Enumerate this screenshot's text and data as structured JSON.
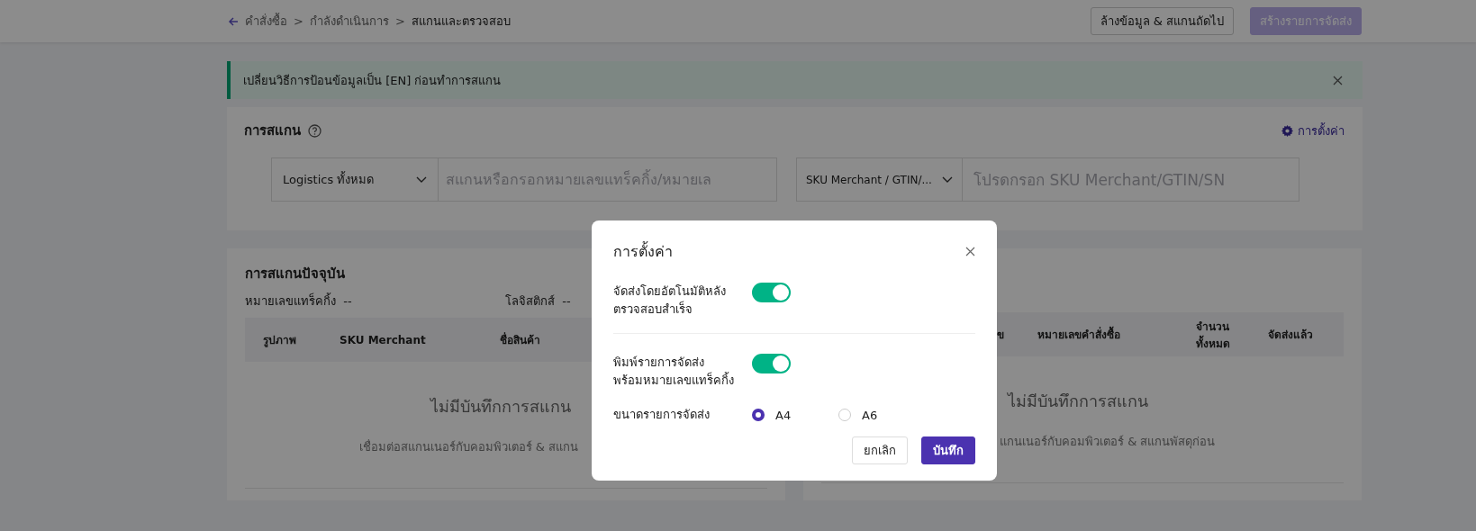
{
  "breadcrumb": {
    "separator": ">",
    "items": [
      {
        "label": "คำสั่งซื้อ",
        "current": false
      },
      {
        "label": "กำลังดำเนินการ",
        "current": false
      },
      {
        "label": "สแกนและตรวจสอบ",
        "current": true
      }
    ]
  },
  "header_buttons": [
    {
      "label": "ล้างข้อมูล & สแกนถัดไป",
      "kind": "outline",
      "disabled": false
    },
    {
      "label": "สร้างรายการจัดส่ง",
      "kind": "primary",
      "disabled": true
    }
  ],
  "alert": {
    "message": "เปลี่ยนวิธีการป้อนข้อมูลเป็น [EN] ก่อนทำการสแกน"
  },
  "scan": {
    "title": "การสแกน",
    "settings_link": "การตั้งค่า",
    "fields": [
      {
        "kind": "select",
        "value": "Logistics ทั้งหมด"
      },
      {
        "kind": "input",
        "placeholder": "สแกนหรือกรอกหมายเลขแทร็คกิ้ง/หมายเล"
      },
      {
        "kind": "select",
        "value": "SKU Merchant / GTIN/..."
      },
      {
        "kind": "input",
        "placeholder": "โปรดกรอก SKU Merchant/GTIN/SN"
      }
    ]
  },
  "current_scan": {
    "title": "การสแกนปัจจุบัน",
    "info": [
      {
        "label": "หมายเลขแทร็คกิ้ง",
        "value": "--"
      },
      {
        "label": "โลจิสติกส์",
        "value": "--"
      }
    ],
    "columns": [
      "รูปภาพ",
      "SKU Merchant",
      "ชื่อสินค้า"
    ],
    "empty_title": "ไม่มีบันทึกการสแกน",
    "empty_hint": "เชื่อมต่อสแกนเนอร์กับคอมพิวเตอร์ & สแกน"
  },
  "scan_results": {
    "columns": [
      "ข",
      "หมายเลขคำสั่งซื้อ",
      "จำนวน\nทั้งหมด",
      "จัดส่งแล้ว"
    ],
    "empty_title": "ไม่มีบันทึกการสแกน",
    "empty_hint": "แกนเนอร์กับคอมพิวเตอร์ & สแกนพัสดุก่อน"
  },
  "modal": {
    "title": "การตั้งค่า",
    "settings": [
      {
        "label": "จัดส่งโดยอัตโนมัติหลัง\nตรวจสอบสำเร็จ",
        "on": true
      },
      {
        "label": "พิมพ์รายการจัดส่ง\nพร้อมหมายเลขแทร็คกิ้ง",
        "on": true
      }
    ],
    "paper_size": {
      "label": "ขนาดรายการจัดส่ง",
      "options": [
        {
          "label": "A4",
          "selected": true
        },
        {
          "label": "A6",
          "selected": false
        }
      ]
    },
    "buttons": [
      {
        "label": "ยกเลิก",
        "kind": "secondary"
      },
      {
        "label": "บันทึก",
        "kind": "primary"
      }
    ]
  }
}
